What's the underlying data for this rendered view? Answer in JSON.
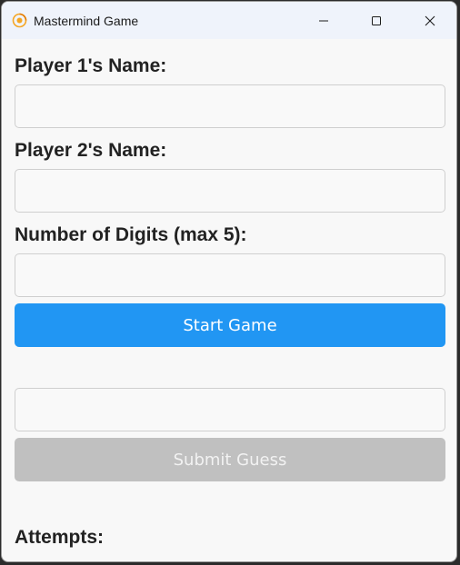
{
  "window": {
    "title": "Mastermind Game",
    "app_icon": "mastermind-app-icon",
    "controls": [
      "minimize-icon",
      "maximize-icon",
      "close-icon"
    ]
  },
  "form": {
    "player1_label": "Player 1's Name:",
    "player1_value": "",
    "player2_label": "Player 2's Name:",
    "player2_value": "",
    "digits_label": "Number of Digits (max 5):",
    "digits_value": "",
    "start_button_label": "Start Game"
  },
  "guess": {
    "guess_value": "",
    "submit_button_label": "Submit Guess",
    "submit_enabled": false
  },
  "attempts": {
    "label": "Attempts:"
  },
  "colors": {
    "start_button": "#2196f3",
    "submit_button_disabled": "#c0c0c0",
    "title_bar": "#eff3fb"
  }
}
